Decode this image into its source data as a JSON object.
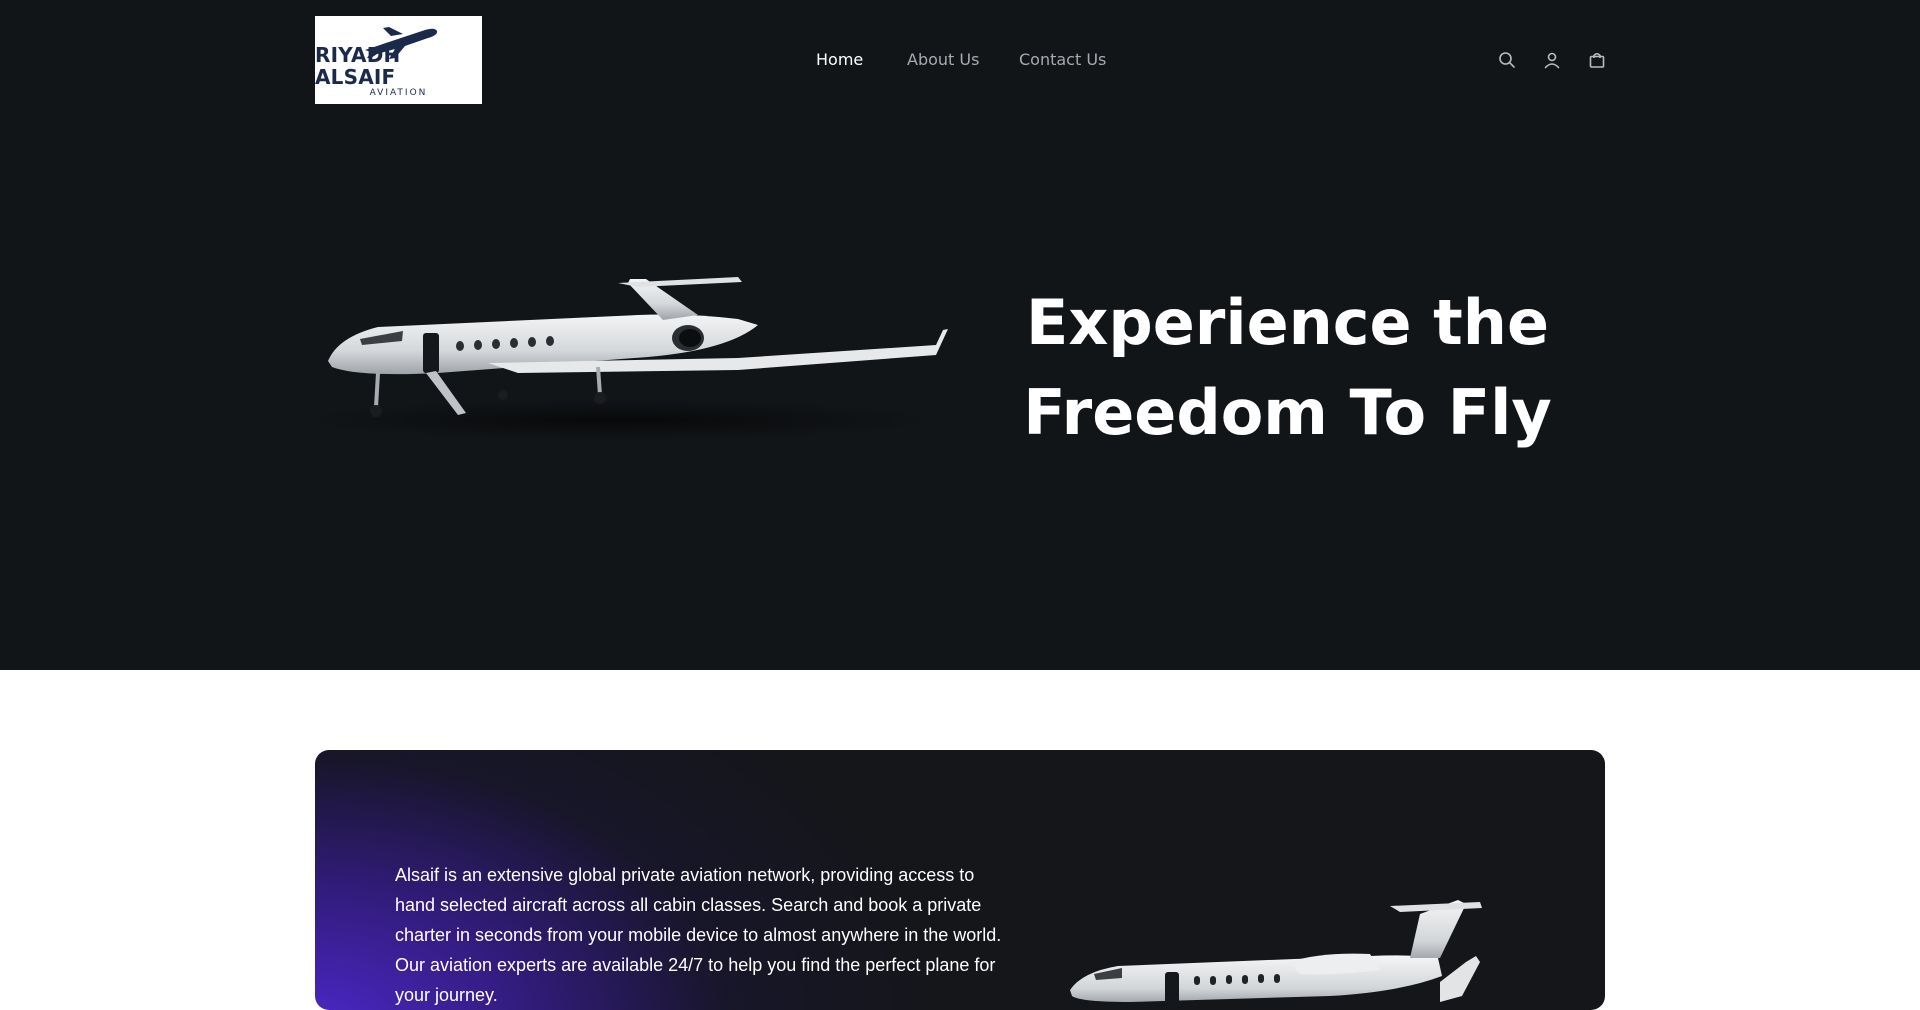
{
  "brand": {
    "name": "RIYADH ALSAIF",
    "tagline": "AVIATION",
    "color": "#1b2a4a"
  },
  "nav": {
    "items": [
      {
        "label": "Home",
        "active": true
      },
      {
        "label": "About Us",
        "active": false
      },
      {
        "label": "Contact Us",
        "active": false
      }
    ]
  },
  "header_icons": [
    "search-icon",
    "account-icon",
    "cart-icon"
  ],
  "hero": {
    "title_line1": "Experience the",
    "title_line2": "Freedom To Fly"
  },
  "about": {
    "text": "Alsaif is an extensive global private aviation network, providing access to hand selected aircraft across all cabin classes.  Search and book a private charter in seconds from your mobile device to almost anywhere in the world. Our aviation experts are available 24/7 to help you find the perfect plane for your journey."
  },
  "colors": {
    "background_dark": "#121518",
    "accent_purple": "#4e28d2",
    "nav_inactive": "#a7abb0",
    "nav_active": "#ffffff"
  }
}
